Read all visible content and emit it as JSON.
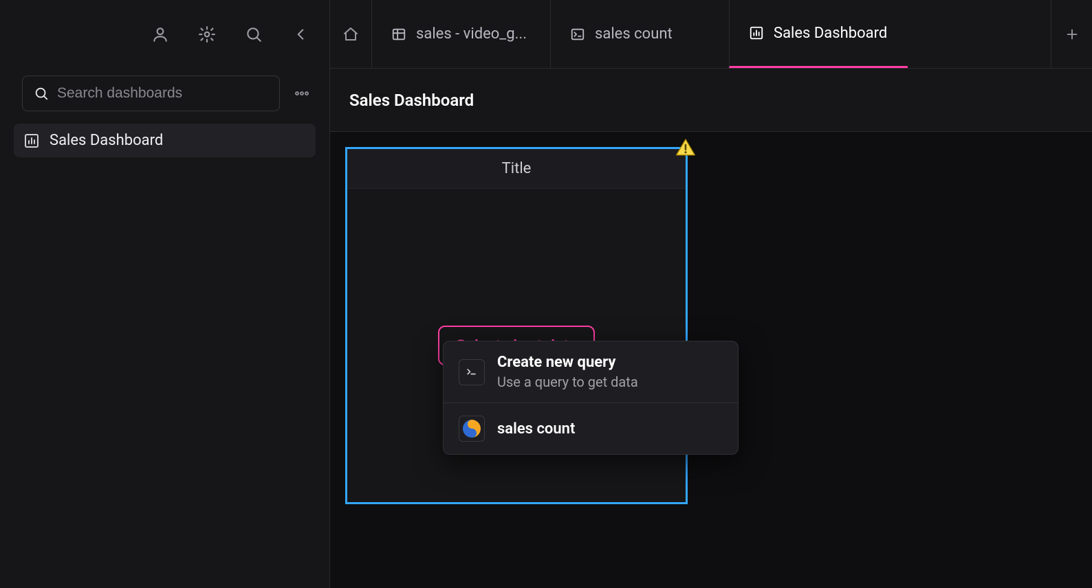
{
  "sidebar": {
    "search_placeholder": "Search dashboards",
    "items": [
      {
        "label": "Sales Dashboard"
      }
    ]
  },
  "tabs": [
    {
      "label": "sales - video_g...",
      "icon": "table"
    },
    {
      "label": "sales count",
      "icon": "terminal"
    },
    {
      "label": "Sales Dashboard",
      "icon": "chart",
      "active": true
    }
  ],
  "page_title": "Sales Dashboard",
  "tile": {
    "title_placeholder": "Title",
    "select_button": "Select chart data"
  },
  "dropdown": {
    "create_title": "Create new query",
    "create_sub": "Use a query to get data",
    "existing": [
      {
        "label": "sales count"
      }
    ]
  }
}
